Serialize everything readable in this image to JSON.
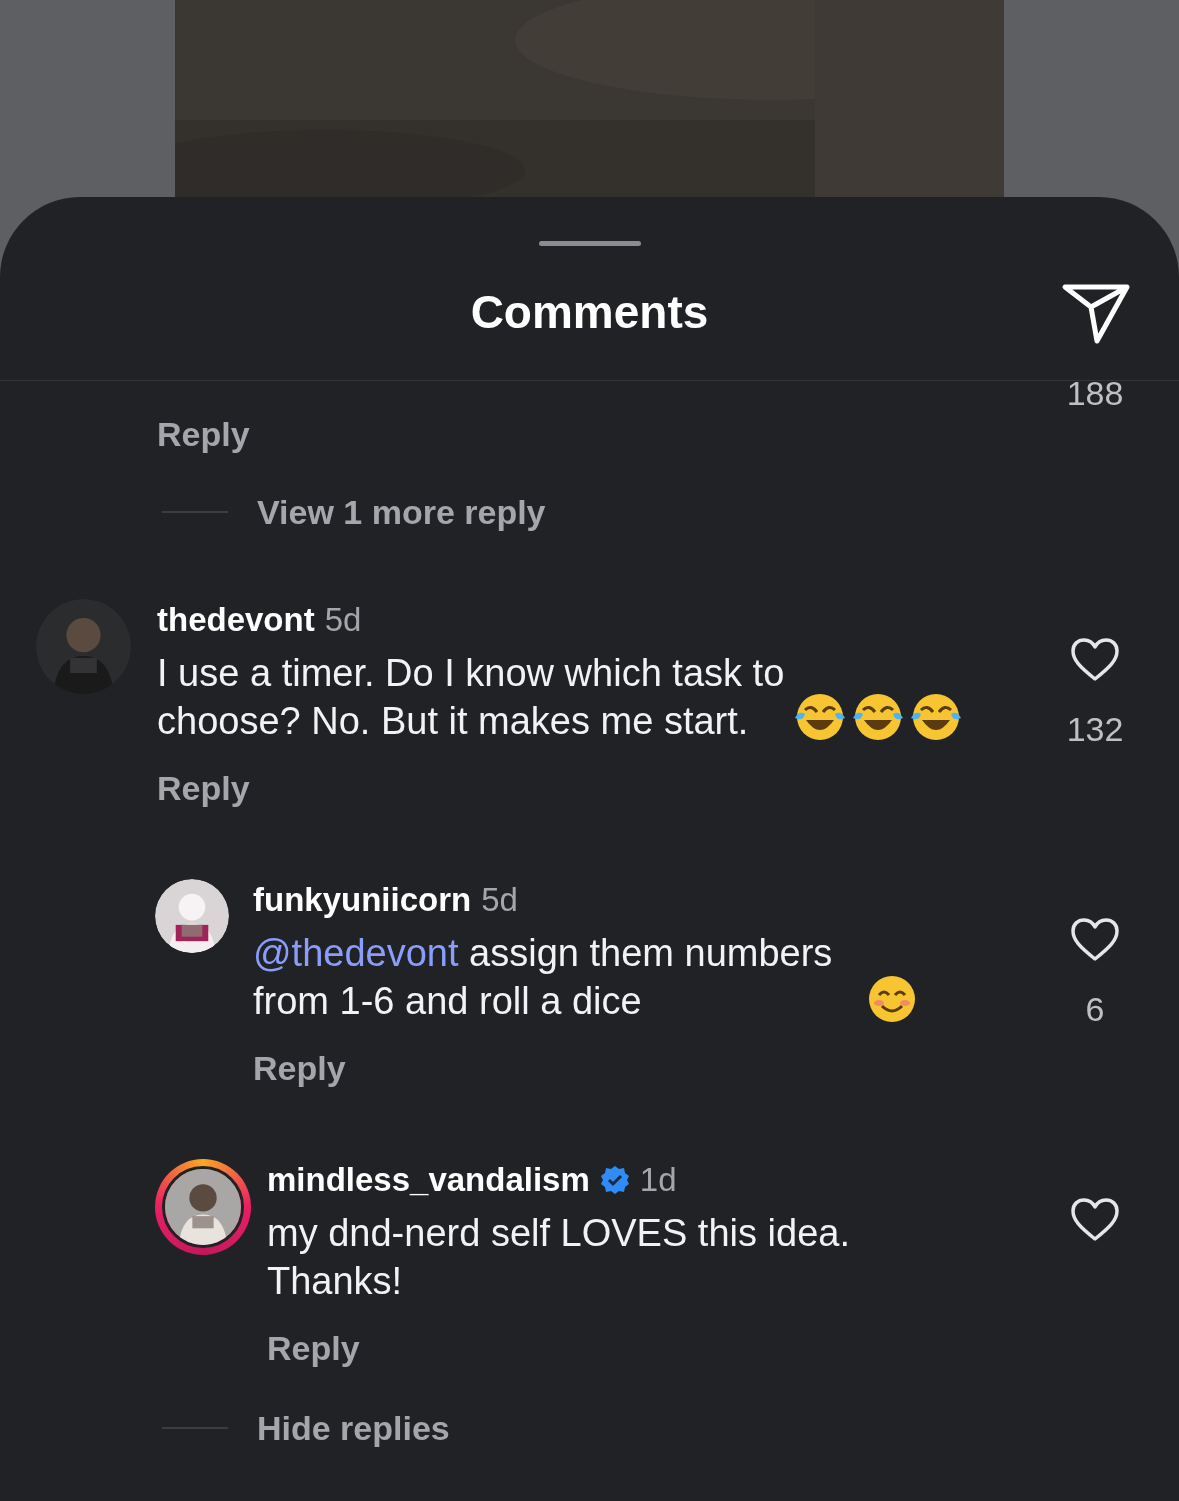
{
  "header": {
    "title": "Comments"
  },
  "comments": [
    {
      "kind": "fragment",
      "likes": "188",
      "reply_label": "Reply",
      "replies_toggle": "View 1 more reply"
    },
    {
      "kind": "comment",
      "username": "thedevont",
      "time": "5d",
      "verified": false,
      "story_ring": false,
      "text": "I use a timer. Do I know which task to choose? No. But it makes me start.",
      "emojis": [
        {
          "kind": "tears-of-joy"
        },
        {
          "kind": "tears-of-joy"
        },
        {
          "kind": "tears-of-joy"
        }
      ],
      "likes": "132",
      "reply_label": "Reply",
      "replies_toggle": "Hide replies",
      "replies": [
        {
          "kind": "comment",
          "username": "funkyuniicorn",
          "time": "5d",
          "verified": false,
          "story_ring": false,
          "mention": "@thedevont",
          "text": "assign them numbers from 1-6 and roll a dice",
          "emojis": [
            {
              "kind": "smiling"
            }
          ],
          "likes": "6",
          "reply_label": "Reply"
        },
        {
          "kind": "comment",
          "username": "mindless_vandalism",
          "time": "1d",
          "verified": true,
          "story_ring": true,
          "text": "my dnd-nerd self LOVES this idea. Thanks!",
          "reply_label": "Reply"
        }
      ]
    }
  ]
}
